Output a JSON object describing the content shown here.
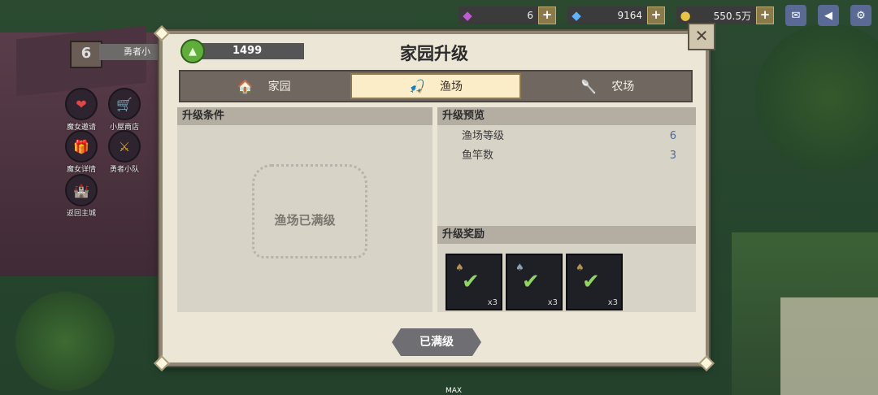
{
  "topbar": {
    "gems": "6",
    "diamonds": "9164",
    "coins": "550.5万",
    "plus": "+"
  },
  "hud": {
    "level": "6",
    "name": "勇者小",
    "side_icons": [
      {
        "label": "魔女邀请",
        "icon": "❤"
      },
      {
        "label": "小屋商店",
        "icon": "🛒"
      },
      {
        "label": "魔女详情",
        "icon": "🎁"
      },
      {
        "label": "勇者小队",
        "icon": "⚔"
      },
      {
        "label": "返回主城",
        "icon": "🏰"
      }
    ]
  },
  "dialog": {
    "title": "家园升级",
    "currency_value": "1499",
    "close_symbol": "✕",
    "tabs": [
      {
        "label": "家园",
        "icon": "🏠"
      },
      {
        "label": "渔场",
        "icon": "🎣"
      },
      {
        "label": "农场",
        "icon": "🥄"
      }
    ],
    "left_section": {
      "header": "升级条件",
      "maxed_text": "渔场已满级"
    },
    "right_section": {
      "header": "升级预览",
      "rows": [
        {
          "label": "渔场等级",
          "value": "6"
        },
        {
          "label": "鱼竿数",
          "value": "3"
        }
      ],
      "reward_header": "升级奖励",
      "rewards": [
        {
          "qty": "x3"
        },
        {
          "qty": "x3"
        },
        {
          "qty": "x3"
        }
      ]
    },
    "action_button": "已满级"
  },
  "footer": {
    "max_label": "MAX"
  },
  "colors": {
    "panel_bg": "#ece6d7",
    "tab_active": "#fbedc8",
    "value_blue": "#4d6a9a"
  }
}
